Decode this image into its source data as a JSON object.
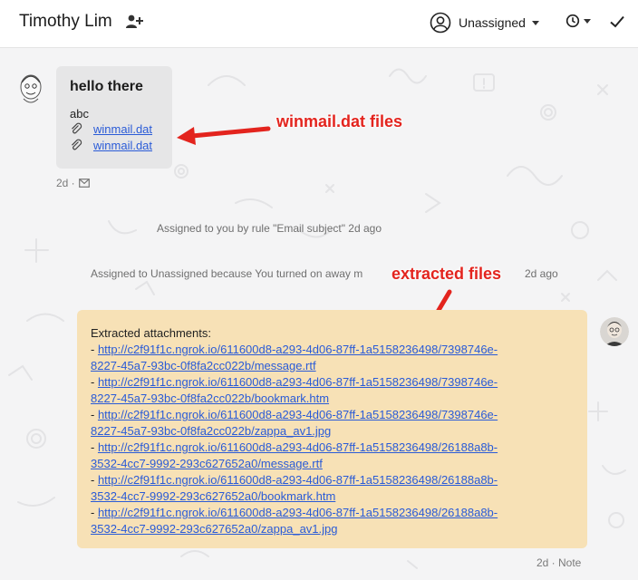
{
  "header": {
    "contact_name": "Timothy Lim",
    "assignee_label": "Unassigned"
  },
  "email": {
    "title": "hello there",
    "body": "abc",
    "attachments": [
      "winmail.dat",
      "winmail.dat"
    ],
    "meta": "2d ·"
  },
  "events": [
    "Assigned to you by rule \"Email subject\" 2d ago",
    "Assigned to Unassigned because You turned on away m",
    "2d ago"
  ],
  "annotations": {
    "winmail": "winmail.dat files",
    "extracted": "extracted files"
  },
  "note": {
    "heading": "Extracted attachments:",
    "links": [
      {
        "line1": "http://c2f91f1c.ngrok.io/611600d8-a293-4d06-87ff-1a5158236498/7398746e-",
        "line2": "8227-45a7-93bc-0f8fa2cc022b/message.rtf"
      },
      {
        "line1": "http://c2f91f1c.ngrok.io/611600d8-a293-4d06-87ff-1a5158236498/7398746e-",
        "line2": "8227-45a7-93bc-0f8fa2cc022b/bookmark.htm"
      },
      {
        "line1": "http://c2f91f1c.ngrok.io/611600d8-a293-4d06-87ff-1a5158236498/7398746e-",
        "line2": "8227-45a7-93bc-0f8fa2cc022b/zappa_av1.jpg"
      },
      {
        "line1": "http://c2f91f1c.ngrok.io/611600d8-a293-4d06-87ff-1a5158236498/26188a8b-",
        "line2": "3532-4cc7-9992-293c627652a0/message.rtf"
      },
      {
        "line1": "http://c2f91f1c.ngrok.io/611600d8-a293-4d06-87ff-1a5158236498/26188a8b-",
        "line2": "3532-4cc7-9992-293c627652a0/bookmark.htm"
      },
      {
        "line1": "http://c2f91f1c.ngrok.io/611600d8-a293-4d06-87ff-1a5158236498/26188a8b-",
        "line2": "3532-4cc7-9992-293c627652a0/zappa_av1.jpg"
      }
    ],
    "meta": "2d · Note"
  },
  "colors": {
    "link": "#2a5bd7",
    "note_bg": "#f7e1b6",
    "annotation": "#e3241e"
  },
  "icons": {
    "add_person": "add-person-icon",
    "assignee": "user-circle-icon",
    "snooze": "clock-icon",
    "done": "checkmark-icon",
    "attachment": "paperclip-icon",
    "email_channel": "envelope-icon"
  }
}
